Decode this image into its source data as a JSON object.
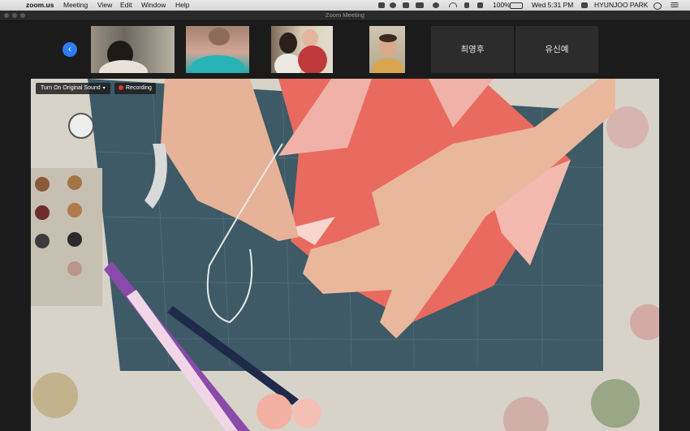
{
  "menubar": {
    "app_name": "zoom.us",
    "menus": [
      "Meeting",
      "View",
      "Edit",
      "Window",
      "Help"
    ],
    "battery": "100%",
    "clock": "Wed 5:31 PM",
    "user": "HYUNJOO PARK"
  },
  "window": {
    "title": "Zoom Meeting"
  },
  "participants": [
    {
      "kind": "video"
    },
    {
      "kind": "video"
    },
    {
      "kind": "video"
    },
    {
      "kind": "video"
    },
    {
      "kind": "name",
      "name": "최영후"
    },
    {
      "kind": "name",
      "name": "유신예"
    }
  ],
  "video_controls": {
    "original_sound_label": "Turn On Original Sound",
    "recording_label": "Recording"
  },
  "colors": {
    "accent": "#2f7bf6",
    "recording": "#e8332f",
    "fabric": "#e96a5f"
  }
}
